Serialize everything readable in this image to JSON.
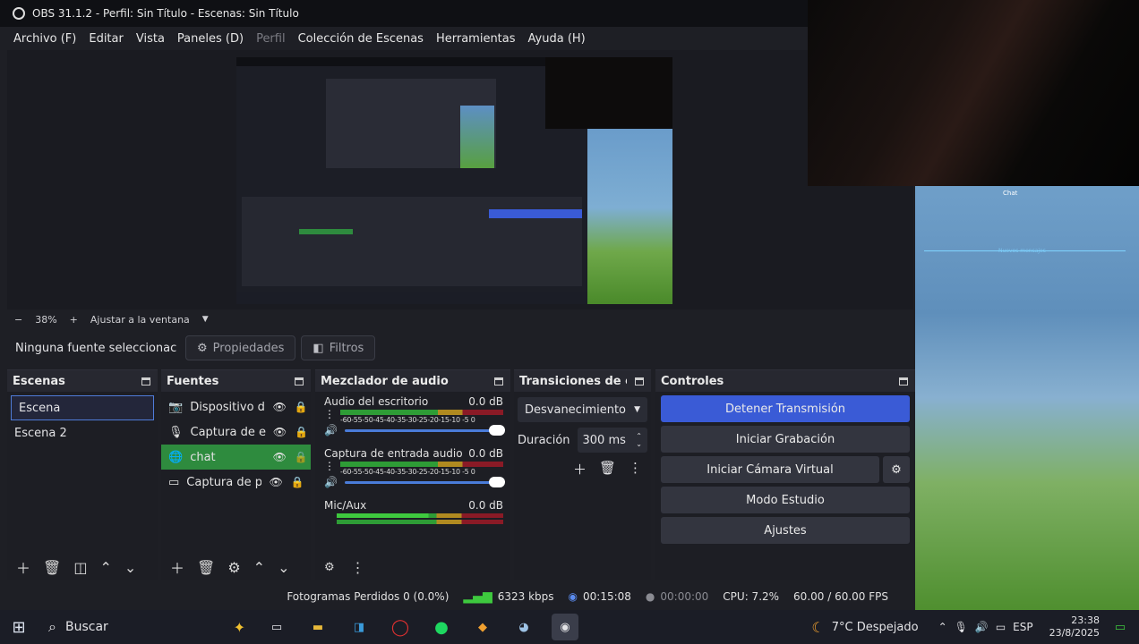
{
  "window": {
    "title": "OBS 31.1.2 - Perfil: Sin Título - Escenas: Sin Título"
  },
  "menu": [
    "Archivo (F)",
    "Editar",
    "Vista",
    "Paneles (D)",
    "Perfil",
    "Colección de Escenas",
    "Herramientas",
    "Ayuda (H)"
  ],
  "chat": {
    "title": "Chat",
    "new_messages": "Nuevos mensajes"
  },
  "zoom": {
    "minus": "−",
    "value": "38%",
    "plus": "+",
    "fit": "Ajustar a la ventana"
  },
  "source_toolbar": {
    "no_source": "Ninguna fuente seleccionac",
    "properties": "Propiedades",
    "filters": "Filtros"
  },
  "scenes": {
    "title": "Escenas",
    "items": [
      "Escena",
      "Escena 2"
    ]
  },
  "sources": {
    "title": "Fuentes",
    "items": [
      "Dispositivo de",
      "Captura de ent",
      "chat",
      "Captura de par"
    ]
  },
  "mixer": {
    "title": "Mezclador de audio",
    "scale": "-60-55-50-45-40-35-30-25-20-15-10 -5 0",
    "channels": [
      {
        "name": "Audio del escritorio",
        "db": "0.0 dB"
      },
      {
        "name": "Captura de entrada audio",
        "db": "0.0 dB"
      },
      {
        "name": "Mic/Aux",
        "db": "0.0 dB"
      }
    ]
  },
  "transitions": {
    "title": "Transiciones de e...",
    "selected": "Desvanecimiento",
    "duration_label": "Duración",
    "duration": "300 ms"
  },
  "controls": {
    "title": "Controles",
    "stop_stream": "Detener Transmisión",
    "start_record": "Iniciar Grabación",
    "start_vcam": "Iniciar Cámara Virtual",
    "studio_mode": "Modo Estudio",
    "settings": "Ajustes"
  },
  "status": {
    "dropped": "Fotogramas Perdidos 0 (0.0%)",
    "bitrate": "6323 kbps",
    "stream_time": "00:15:08",
    "rec_time": "00:00:00",
    "cpu": "CPU: 7.2%",
    "fps": "60.00 / 60.00 FPS"
  },
  "taskbar": {
    "search": "Buscar",
    "weather": "7°C  Despejado",
    "lang": "ESP",
    "time": "23:38",
    "date": "23/8/2025"
  },
  "colors": {
    "accent": "#3a5bd6",
    "selected_source": "#2e8b3e"
  }
}
